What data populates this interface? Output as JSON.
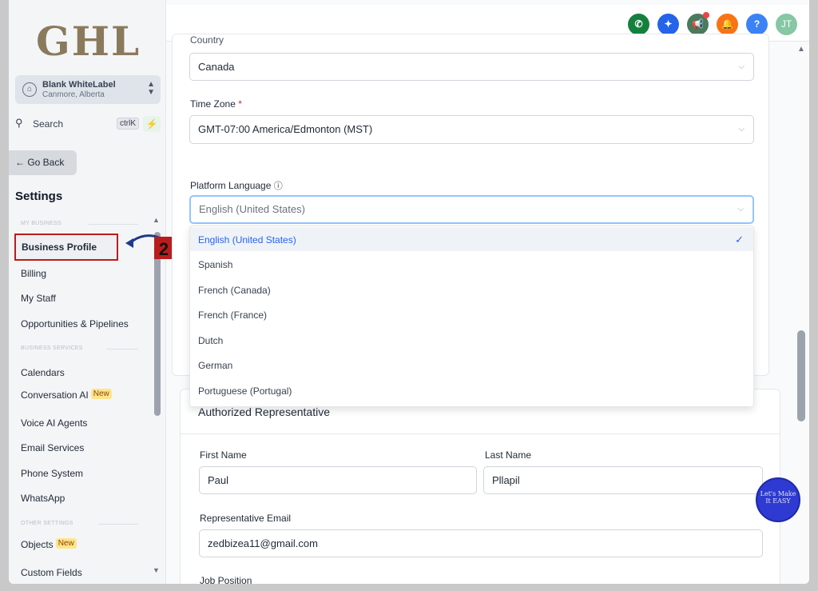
{
  "logo": "GHL",
  "account": {
    "name": "Blank WhiteLabel",
    "location": "Canmore, Alberta"
  },
  "search": {
    "label": "Search",
    "shortcut": "ctrlK"
  },
  "go_back": "← Go Back",
  "settings_title": "Settings",
  "sections": {
    "my_business": "MY BUSINESS",
    "business_services": "BUSINESS SERVICES",
    "other_settings": "OTHER SETTINGS"
  },
  "nav": {
    "business_profile": "Business Profile",
    "billing": "Billing",
    "my_staff": "My Staff",
    "opportunities": "Opportunities & Pipelines",
    "calendars": "Calendars",
    "conversation_ai": "Conversation AI",
    "voice_ai": "Voice AI Agents",
    "email_services": "Email Services",
    "phone_system": "Phone System",
    "whatsapp": "WhatsApp",
    "objects": "Objects",
    "custom_fields": "Custom Fields",
    "new_badge": "New"
  },
  "step_number": "2",
  "topbar": {
    "help": "?",
    "avatar": "JT"
  },
  "form": {
    "country_label": "Country",
    "country_value": "Canada",
    "timezone_label": "Time Zone",
    "timezone_required": "*",
    "timezone_value": "GMT-07:00 America/Edmonton (MST)",
    "platform_language_label": "Platform Language",
    "platform_language_value": "English (United States)",
    "authorized_rep_title": "Authorized Representative",
    "first_name_label": "First Name",
    "first_name_value": "Paul",
    "last_name_label": "Last Name",
    "last_name_value": "Pllapil",
    "rep_email_label": "Representative Email",
    "rep_email_value": "zedbizea11@gmail.com",
    "job_position_label": "Job Position"
  },
  "language_options": [
    "English (United States)",
    "Spanish",
    "French (Canada)",
    "French (France)",
    "Dutch",
    "German",
    "Portuguese (Portugal)"
  ],
  "floating_badge": "Let's Make It EASY",
  "colors": {
    "phone": "#15803d",
    "star": "#2563eb",
    "megaphone": "#4b7a5c",
    "bell": "#f97316",
    "help": "#3b82f6",
    "avatar": "#86c7a4",
    "highlight": "#b91c1c"
  }
}
